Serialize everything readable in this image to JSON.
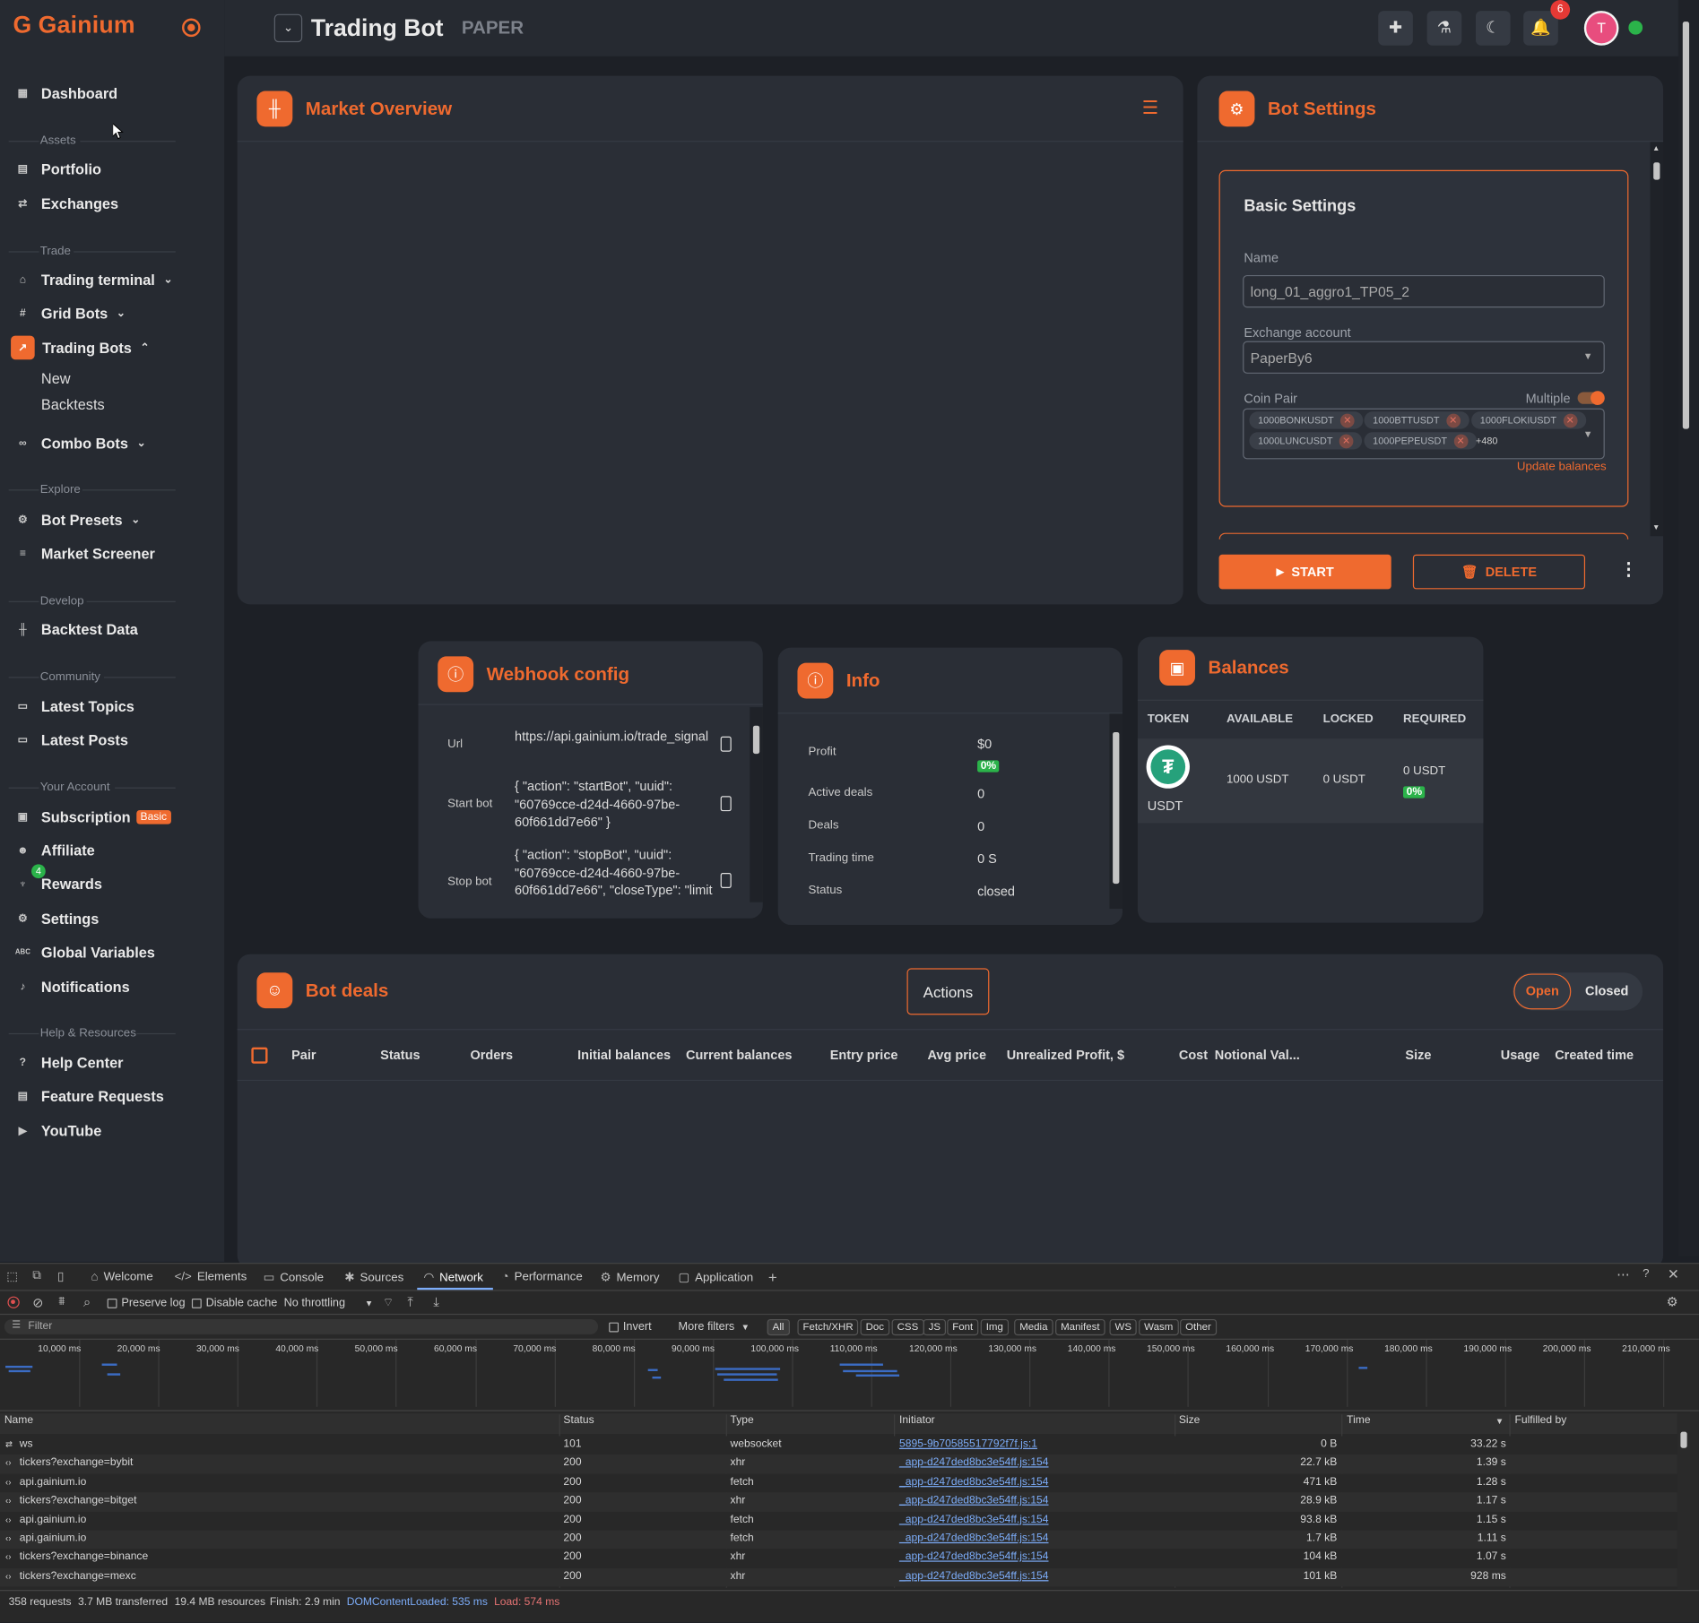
{
  "app": {
    "name": "Gainium"
  },
  "header": {
    "title": "Trading Bot",
    "mode": "PAPER",
    "notif_count": "6",
    "avatar_letter": "T"
  },
  "sidebar": {
    "dashboard": "Dashboard",
    "assets_section": "Assets",
    "portfolio": "Portfolio",
    "exchanges": "Exchanges",
    "trade_section": "Trade",
    "trading_terminal": "Trading terminal",
    "grid_bots": "Grid Bots",
    "trading_bots": "Trading Bots",
    "trading_bots_new": "New",
    "trading_bots_backtests": "Backtests",
    "combo_bots": "Combo Bots",
    "explore_section": "Explore",
    "bot_presets": "Bot Presets",
    "market_screener": "Market Screener",
    "develop_section": "Develop",
    "backtest_data": "Backtest Data",
    "community_section": "Community",
    "latest_topics": "Latest Topics",
    "latest_posts": "Latest Posts",
    "account_section": "Your Account",
    "subscription": "Subscription",
    "subscription_badge": "Basic",
    "affiliate": "Affiliate",
    "rewards": "Rewards",
    "rewards_badge": "4",
    "settings": "Settings",
    "global_variables": "Global Variables",
    "global_variables_icon": "ABC",
    "notifications": "Notifications",
    "help_section": "Help & Resources",
    "help_center": "Help Center",
    "feature_requests": "Feature Requests",
    "youtube": "YouTube"
  },
  "market_overview": {
    "title": "Market Overview"
  },
  "bot_settings": {
    "title": "Bot Settings",
    "section_title": "Basic Settings",
    "name_label": "Name",
    "name_value": "long_01_aggro1_TP05_2",
    "exchange_label": "Exchange account",
    "exchange_value": "PaperBy6",
    "coin_pair_label": "Coin Pair",
    "multiple_label": "Multiple",
    "pairs": [
      "1000BONKUSDT",
      "1000BTTUSDT",
      "1000FLOKIUSDT",
      "1000LUNCUSDT",
      "1000PEPEUSDT"
    ],
    "more_pairs": "+480",
    "update_balances": "Update balances",
    "start_label": "START",
    "delete_label": "DELETE"
  },
  "webhook": {
    "title": "Webhook config",
    "url_label": "Url",
    "url_value": "https://api.gainium.io/trade_signal",
    "start_label": "Start bot",
    "start_value": "{ \"action\": \"startBot\", \"uuid\": \"60769cce-d24d-4660-97be-60f661dd7e66\" }",
    "stop_label": "Stop bot",
    "stop_value": "{ \"action\": \"stopBot\", \"uuid\": \"60769cce-d24d-4660-97be-60f661dd7e66\", \"closeType\": \"limit"
  },
  "info": {
    "title": "Info",
    "profit_label": "Profit",
    "profit_value": "$0",
    "profit_pct": "0%",
    "active_deals_label": "Active deals",
    "active_deals_value": "0",
    "deals_label": "Deals",
    "deals_value": "0",
    "trading_time_label": "Trading time",
    "trading_time_value": "0 S",
    "status_label": "Status",
    "status_value": "closed"
  },
  "balances": {
    "title": "Balances",
    "headers": {
      "token": "TOKEN",
      "available": "AVAILABLE",
      "locked": "LOCKED",
      "required": "REQUIRED"
    },
    "row": {
      "token": "USDT",
      "available": "1000 USDT",
      "locked": "0 USDT",
      "required": "0 USDT",
      "required_pct": "0%"
    }
  },
  "bot_deals": {
    "title": "Bot deals",
    "actions_label": "Actions",
    "open_label": "Open",
    "closed_label": "Closed",
    "columns": [
      "Pair",
      "Status",
      "Orders",
      "Initial balances",
      "Current balances",
      "Entry price",
      "Avg price",
      "Unrealized Profit, $",
      "Cost",
      "Notional Val...",
      "Size",
      "Usage",
      "Created time"
    ]
  },
  "devtools": {
    "tabs": [
      "Welcome",
      "Elements",
      "Console",
      "Sources",
      "Network",
      "Performance",
      "Memory",
      "Application"
    ],
    "preserve_log": "Preserve log",
    "disable_cache": "Disable cache",
    "throttling": "No throttling",
    "filter_placeholder": "Filter",
    "invert": "Invert",
    "more_filters": "More filters",
    "types": [
      "All",
      "Fetch/XHR",
      "Doc",
      "CSS",
      "JS",
      "Font",
      "Img",
      "Media",
      "Manifest",
      "WS",
      "Wasm",
      "Other"
    ],
    "timeline_labels": [
      "10,000 ms",
      "20,000 ms",
      "30,000 ms",
      "40,000 ms",
      "50,000 ms",
      "60,000 ms",
      "70,000 ms",
      "80,000 ms",
      "90,000 ms",
      "100,000 ms",
      "110,000 ms",
      "120,000 ms",
      "130,000 ms",
      "140,000 ms",
      "150,000 ms",
      "160,000 ms",
      "170,000 ms",
      "180,000 ms",
      "190,000 ms",
      "200,000 ms",
      "210,000 ms"
    ],
    "columns": [
      "Name",
      "Status",
      "Type",
      "Initiator",
      "Size",
      "Time",
      "Fulfilled by"
    ],
    "rows": [
      {
        "name": "ws",
        "status": "101",
        "type": "websocket",
        "initiator": "5895-9b70585517792f7f.js:1",
        "size": "0 B",
        "time": "33.22 s"
      },
      {
        "name": "tickers?exchange=bybit",
        "status": "200",
        "type": "xhr",
        "initiator": "_app-d247ded8bc3e54ff.js:154",
        "size": "22.7 kB",
        "time": "1.39 s"
      },
      {
        "name": "api.gainium.io",
        "status": "200",
        "type": "fetch",
        "initiator": "_app-d247ded8bc3e54ff.js:154",
        "size": "471 kB",
        "time": "1.28 s"
      },
      {
        "name": "tickers?exchange=bitget",
        "status": "200",
        "type": "xhr",
        "initiator": "_app-d247ded8bc3e54ff.js:154",
        "size": "28.9 kB",
        "time": "1.17 s"
      },
      {
        "name": "api.gainium.io",
        "status": "200",
        "type": "fetch",
        "initiator": "_app-d247ded8bc3e54ff.js:154",
        "size": "93.8 kB",
        "time": "1.15 s"
      },
      {
        "name": "api.gainium.io",
        "status": "200",
        "type": "fetch",
        "initiator": "_app-d247ded8bc3e54ff.js:154",
        "size": "1.7 kB",
        "time": "1.11 s"
      },
      {
        "name": "tickers?exchange=binance",
        "status": "200",
        "type": "xhr",
        "initiator": "_app-d247ded8bc3e54ff.js:154",
        "size": "104 kB",
        "time": "1.07 s"
      },
      {
        "name": "tickers?exchange=mexc",
        "status": "200",
        "type": "xhr",
        "initiator": "_app-d247ded8bc3e54ff.js:154",
        "size": "101 kB",
        "time": "928 ms"
      }
    ],
    "status": {
      "requests": "358 requests",
      "transferred": "3.7 MB transferred",
      "resources": "19.4 MB resources",
      "finish": "Finish: 2.9 min",
      "dcl": "DOMContentLoaded: 535 ms",
      "load": "Load: 574 ms"
    }
  }
}
